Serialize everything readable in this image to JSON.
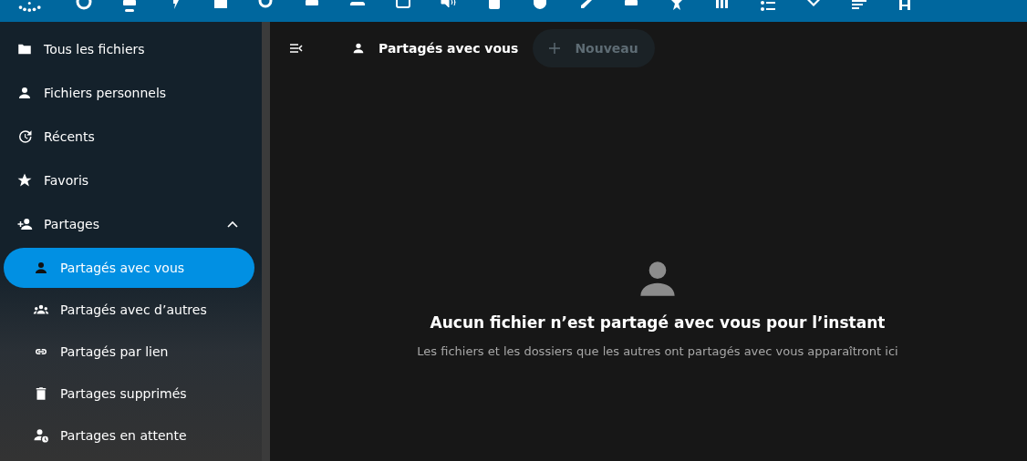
{
  "sidebar": {
    "items": [
      {
        "label": "Tous les fichiers",
        "selected": false
      },
      {
        "label": "Fichiers personnels",
        "selected": false
      },
      {
        "label": "Récents",
        "selected": false
      },
      {
        "label": "Favoris",
        "selected": false
      },
      {
        "label": "Partages",
        "selected": false,
        "expanded": true,
        "children": [
          {
            "label": "Partagés avec vous",
            "selected": true
          },
          {
            "label": "Partagés avec d’autres",
            "selected": false
          },
          {
            "label": "Partagés par lien",
            "selected": false
          },
          {
            "label": "Partages supprimés",
            "selected": false
          },
          {
            "label": "Partages en attente",
            "selected": false
          }
        ]
      }
    ]
  },
  "breadcrumb": {
    "label": "Partagés avec vous"
  },
  "new_button": {
    "label": "Nouveau",
    "disabled": true
  },
  "empty_state": {
    "title": "Aucun fichier n’est partagé avec vous pour l’instant",
    "description": "Les fichiers et les dossiers que les autres ont partagés avec vous apparaîtront ici"
  }
}
